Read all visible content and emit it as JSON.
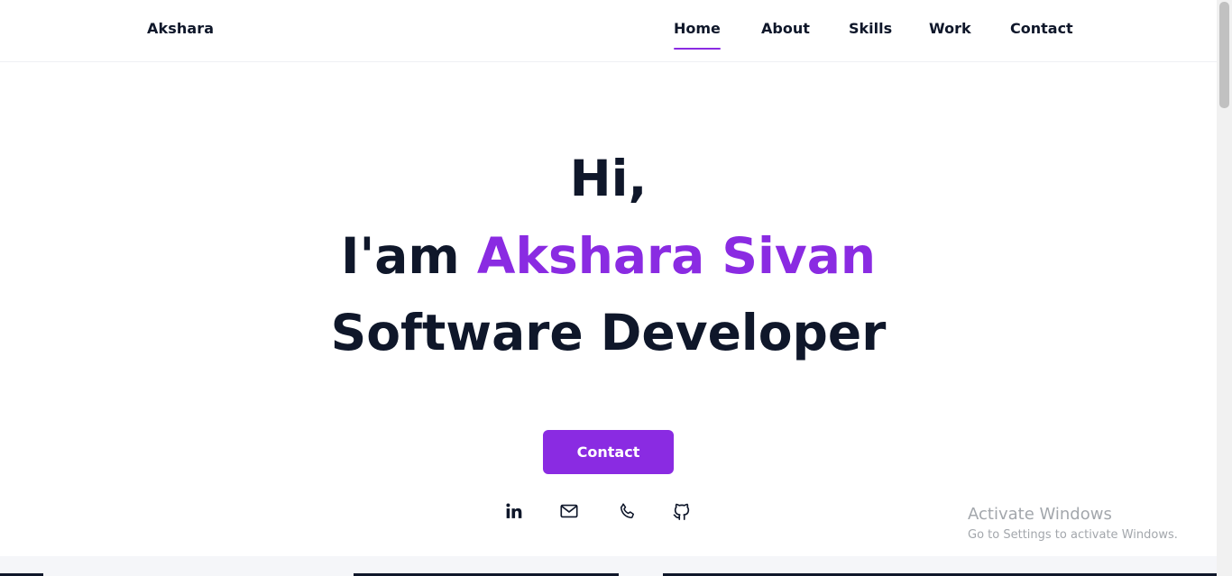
{
  "header": {
    "brand": "Akshara",
    "nav": [
      {
        "label": "Home",
        "active": true
      },
      {
        "label": "About",
        "active": false
      },
      {
        "label": "Skills",
        "active": false
      },
      {
        "label": "Work",
        "active": false
      },
      {
        "label": "Contact",
        "active": false
      }
    ]
  },
  "hero": {
    "greeting": "Hi,",
    "intro_prefix": "I'am ",
    "name": "Akshara Sivan",
    "role": "Software Developer",
    "button_label": "Contact"
  },
  "social": [
    {
      "icon": "linkedin-icon"
    },
    {
      "icon": "mail-icon"
    },
    {
      "icon": "phone-icon"
    },
    {
      "icon": "github-icon"
    }
  ],
  "colors": {
    "accent": "#8a2be2",
    "text": "#0f172a"
  },
  "os_watermark": {
    "title": "Activate Windows",
    "subtitle": "Go to Settings to activate Windows."
  }
}
